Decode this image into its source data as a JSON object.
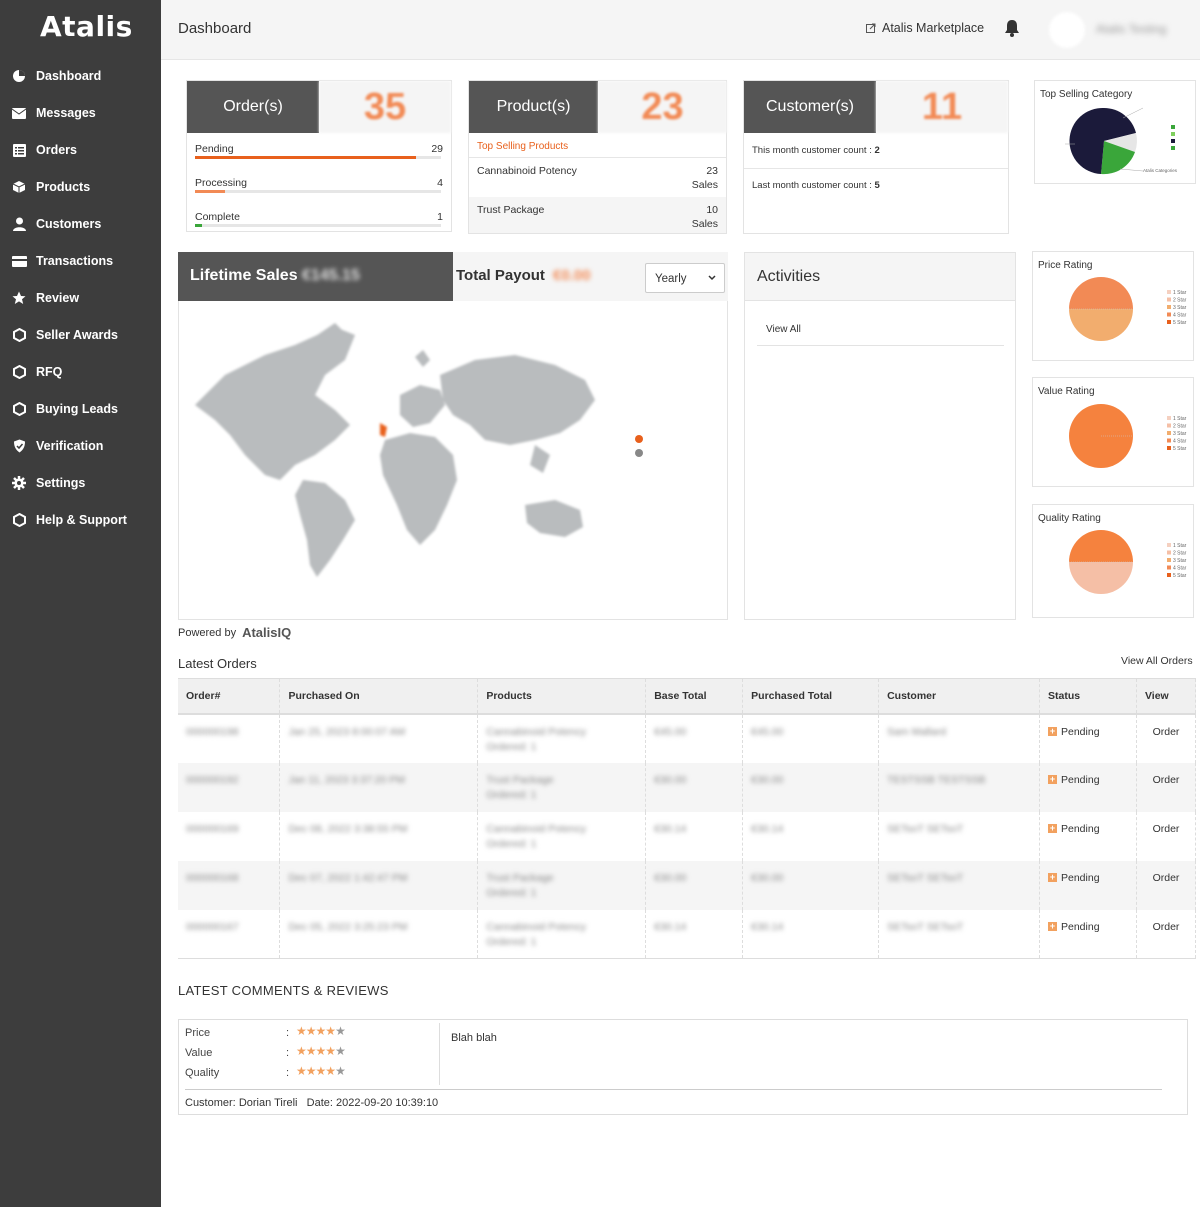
{
  "app": {
    "logo": "Atalis"
  },
  "sidebar": {
    "items": [
      {
        "label": "Dashboard",
        "icon": "pie-chart-icon"
      },
      {
        "label": "Messages",
        "icon": "envelope-icon"
      },
      {
        "label": "Orders",
        "icon": "list-icon"
      },
      {
        "label": "Products",
        "icon": "box-icon"
      },
      {
        "label": "Customers",
        "icon": "user-icon"
      },
      {
        "label": "Transactions",
        "icon": "credit-card-icon"
      },
      {
        "label": "Review",
        "icon": "star-icon"
      },
      {
        "label": "Seller Awards",
        "icon": "hexagon-icon"
      },
      {
        "label": "RFQ",
        "icon": "hexagon-icon"
      },
      {
        "label": "Buying Leads",
        "icon": "hexagon-icon"
      },
      {
        "label": "Verification",
        "icon": "shield-check-icon"
      },
      {
        "label": "Settings",
        "icon": "gear-icon"
      },
      {
        "label": "Help & Support",
        "icon": "hexagon-icon"
      }
    ]
  },
  "header": {
    "title": "Dashboard",
    "marketplace_link": "Atalis Marketplace",
    "username": "Atalis Testing"
  },
  "orders_card": {
    "title": "Order(s)",
    "count": "35",
    "rows": [
      {
        "label": "Pending",
        "count": "29",
        "fill": 0.9,
        "color": "#e8601c"
      },
      {
        "label": "Processing",
        "count": "4",
        "fill": 0.12,
        "color": "#f28a55"
      },
      {
        "label": "Complete",
        "count": "1",
        "fill": 0.03,
        "color": "#3aa63a"
      }
    ]
  },
  "products_card": {
    "title": "Product(s)",
    "count": "23",
    "top_selling_label": "Top Selling Products",
    "items": [
      {
        "name": "Cannabinoid Potency",
        "count": "23",
        "unit": "Sales"
      },
      {
        "name": "Trust Package",
        "count": "10",
        "unit": "Sales"
      }
    ]
  },
  "customers_card": {
    "title": "Customer(s)",
    "count": "11",
    "this_month_label": "This month customer count : ",
    "this_month_value": "2",
    "last_month_label": "Last month customer count : ",
    "last_month_value": "5"
  },
  "charts": {
    "category": {
      "title": "Top Selling Category",
      "legend_title": "Atalis Categories"
    },
    "price": {
      "title": "Price Rating"
    },
    "value": {
      "title": "Value Rating"
    },
    "quality": {
      "title": "Quality Rating"
    },
    "rating_legend": [
      "1 Star",
      "2 Star",
      "3 Star",
      "4 Star",
      "5 Star"
    ]
  },
  "sales": {
    "lifetime_label": "Lifetime Sales",
    "lifetime_value": "€145.15",
    "payout_label": "Total Payout",
    "payout_value": "€0.00",
    "period": "Yearly",
    "period_options": [
      "Yearly"
    ]
  },
  "powered_by": {
    "label": "Powered by",
    "brand": "AtalisIQ"
  },
  "activities": {
    "title": "Activities",
    "view_all": "View All"
  },
  "latest_orders": {
    "title": "Latest Orders",
    "view_all": "View All Orders",
    "columns": [
      "Order#",
      "Purchased On",
      "Products",
      "Base Total",
      "Purchased Total",
      "Customer",
      "Status",
      "View"
    ],
    "rows": [
      {
        "order": "000000198",
        "date": "Jan 25, 2023 8:00:07 AM",
        "product": "Cannabinoid Potency",
        "ordered": "Ordered: 1",
        "base": "€45.00",
        "total": "€45.00",
        "customer": "Sam Mallard",
        "status": "Pending",
        "view": "Order"
      },
      {
        "order": "000000192",
        "date": "Jan 11, 2023 3:37:20 PM",
        "product": "Trust Package",
        "ordered": "Ordered: 1",
        "base": "€30.00",
        "total": "€30.00",
        "customer": "TESTSSB TESTSSB",
        "status": "Pending",
        "view": "Order"
      },
      {
        "order": "000000169",
        "date": "Dec 08, 2022 3:38:55 PM",
        "product": "Cannabinoid Potency",
        "ordered": "Ordered: 1",
        "base": "€30.14",
        "total": "€30.14",
        "customer": "SETsoT SETsoT",
        "status": "Pending",
        "view": "Order"
      },
      {
        "order": "000000168",
        "date": "Dec 07, 2022 1:42:47 PM",
        "product": "Trust Package",
        "ordered": "Ordered: 1",
        "base": "€30.00",
        "total": "€30.00",
        "customer": "SETsoT SETsoT",
        "status": "Pending",
        "view": "Order"
      },
      {
        "order": "000000167",
        "date": "Dec 05, 2022 3:25:23 PM",
        "product": "Cannabinoid Potency",
        "ordered": "Ordered: 1",
        "base": "€30.14",
        "total": "€30.14",
        "customer": "SETsoT SETsoT",
        "status": "Pending",
        "view": "Order"
      }
    ]
  },
  "reviews": {
    "title": "LATEST COMMENTS & REVIEWS",
    "ratings": [
      {
        "label": "Price",
        "stars": 4,
        "out_of": 5
      },
      {
        "label": "Value",
        "stars": 4,
        "out_of": 5
      },
      {
        "label": "Quality",
        "stars": 4,
        "out_of": 5
      }
    ],
    "colon": ":",
    "comment": "Blah blah",
    "customer_label": "Customer:",
    "customer_name": "Dorian Tireli",
    "date_label": "Date:",
    "date_value": "2022-09-20 10:39:10"
  }
}
